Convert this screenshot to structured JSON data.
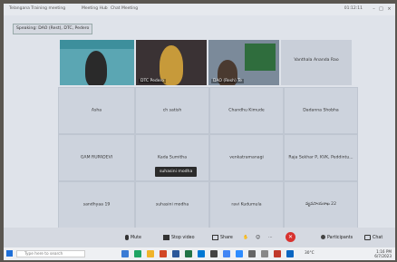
{
  "window": {
    "tabs": [
      "Telangana Training meeting",
      "Meeting Hub",
      "Chat Meeting"
    ],
    "clock": "01:12:11"
  },
  "speaking": "Speaking: DAO (Rest), DTC, Pedero",
  "video_tiles": [
    {
      "name": ""
    },
    {
      "name": "DTC Pedero"
    },
    {
      "name": "DAO (Resh) Te"
    },
    {
      "name": "Vanthala Ananda Rao"
    }
  ],
  "participants": [
    "Asha",
    "ch satish",
    "Chandhu Kimude",
    "Dadanna Shobha",
    "GAM RUPADEVI",
    "Kada Sumitha",
    "venkatramanagi",
    "Raja Sekhar P, KVK, Peddintu...",
    "sandhyaa 19",
    "suhasini modha",
    "ravi Kudumula",
    "వ్యవసాయశాఖ 22"
  ],
  "tooltip": "suhasini modha",
  "controls": {
    "mute": "Mute",
    "stop_video": "Stop video",
    "share": "Share",
    "participants": "Participants",
    "chat": "Chat"
  },
  "taskbar": {
    "search_placeholder": "Type here to search",
    "weather": "30°C",
    "time": "1:16 PM",
    "date": "6/7/2023"
  },
  "colors": {
    "leave": "#d8322f",
    "accent": "#2b62c0"
  }
}
